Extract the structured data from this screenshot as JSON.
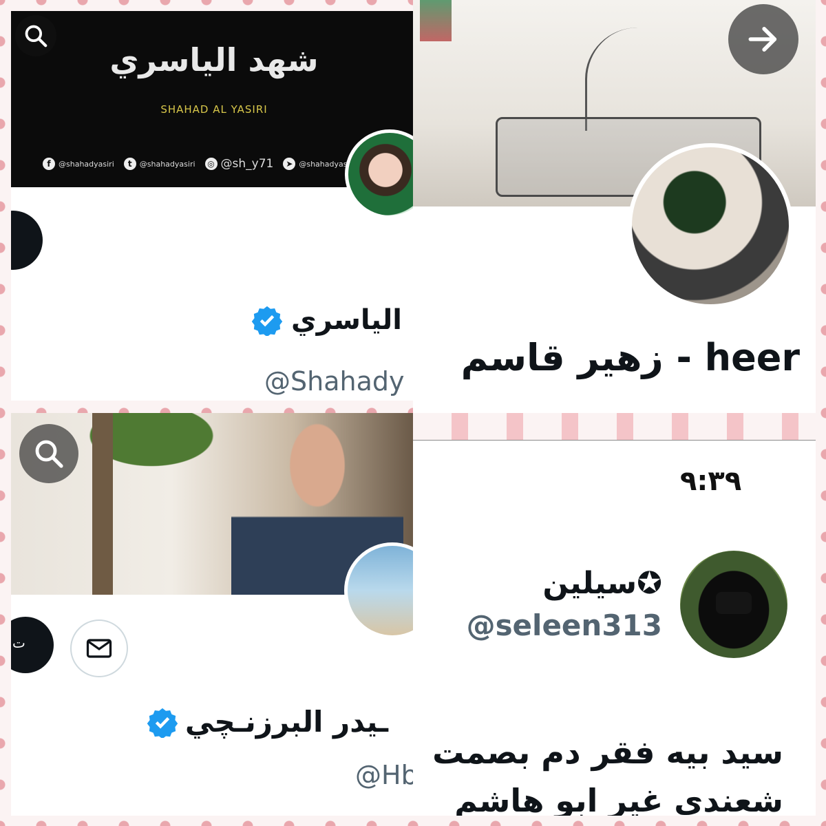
{
  "collage": {
    "p1": {
      "banner_title": "شهد الياسري",
      "banner_subtitle": "SHAHAD AL YASIRI",
      "socials": [
        {
          "icon": "facebook-icon",
          "glyph": "f",
          "text": "@shahadyasiri"
        },
        {
          "icon": "twitter-icon",
          "glyph": "t",
          "text": "@shahadyasiri"
        },
        {
          "icon": "instagram-icon",
          "glyph": "◎",
          "text": "@sh_y71"
        },
        {
          "icon": "telegram-icon",
          "glyph": "➤",
          "text": "@shahadyasiri"
        }
      ],
      "display_name": "الياسري",
      "handle": "@Shahady",
      "verified_color": "#1d9bf0"
    },
    "p2": {
      "display_name": "زهير قاسم - heer",
      "next_icon": "arrow-right-icon"
    },
    "p3": {
      "button_glyph": "ت",
      "display_name": "ـيدر البرزنـچي",
      "handle": "@Hb",
      "verified_color": "#1d9bf0"
    },
    "p4": {
      "time": "٩:٣٩",
      "display_name": "سيلين✪",
      "handle": "@seleen313",
      "tweet_line1": "سيد بيه فقر دم بصمت",
      "tweet_line2": "شعندی غير ابو هاشم"
    }
  }
}
